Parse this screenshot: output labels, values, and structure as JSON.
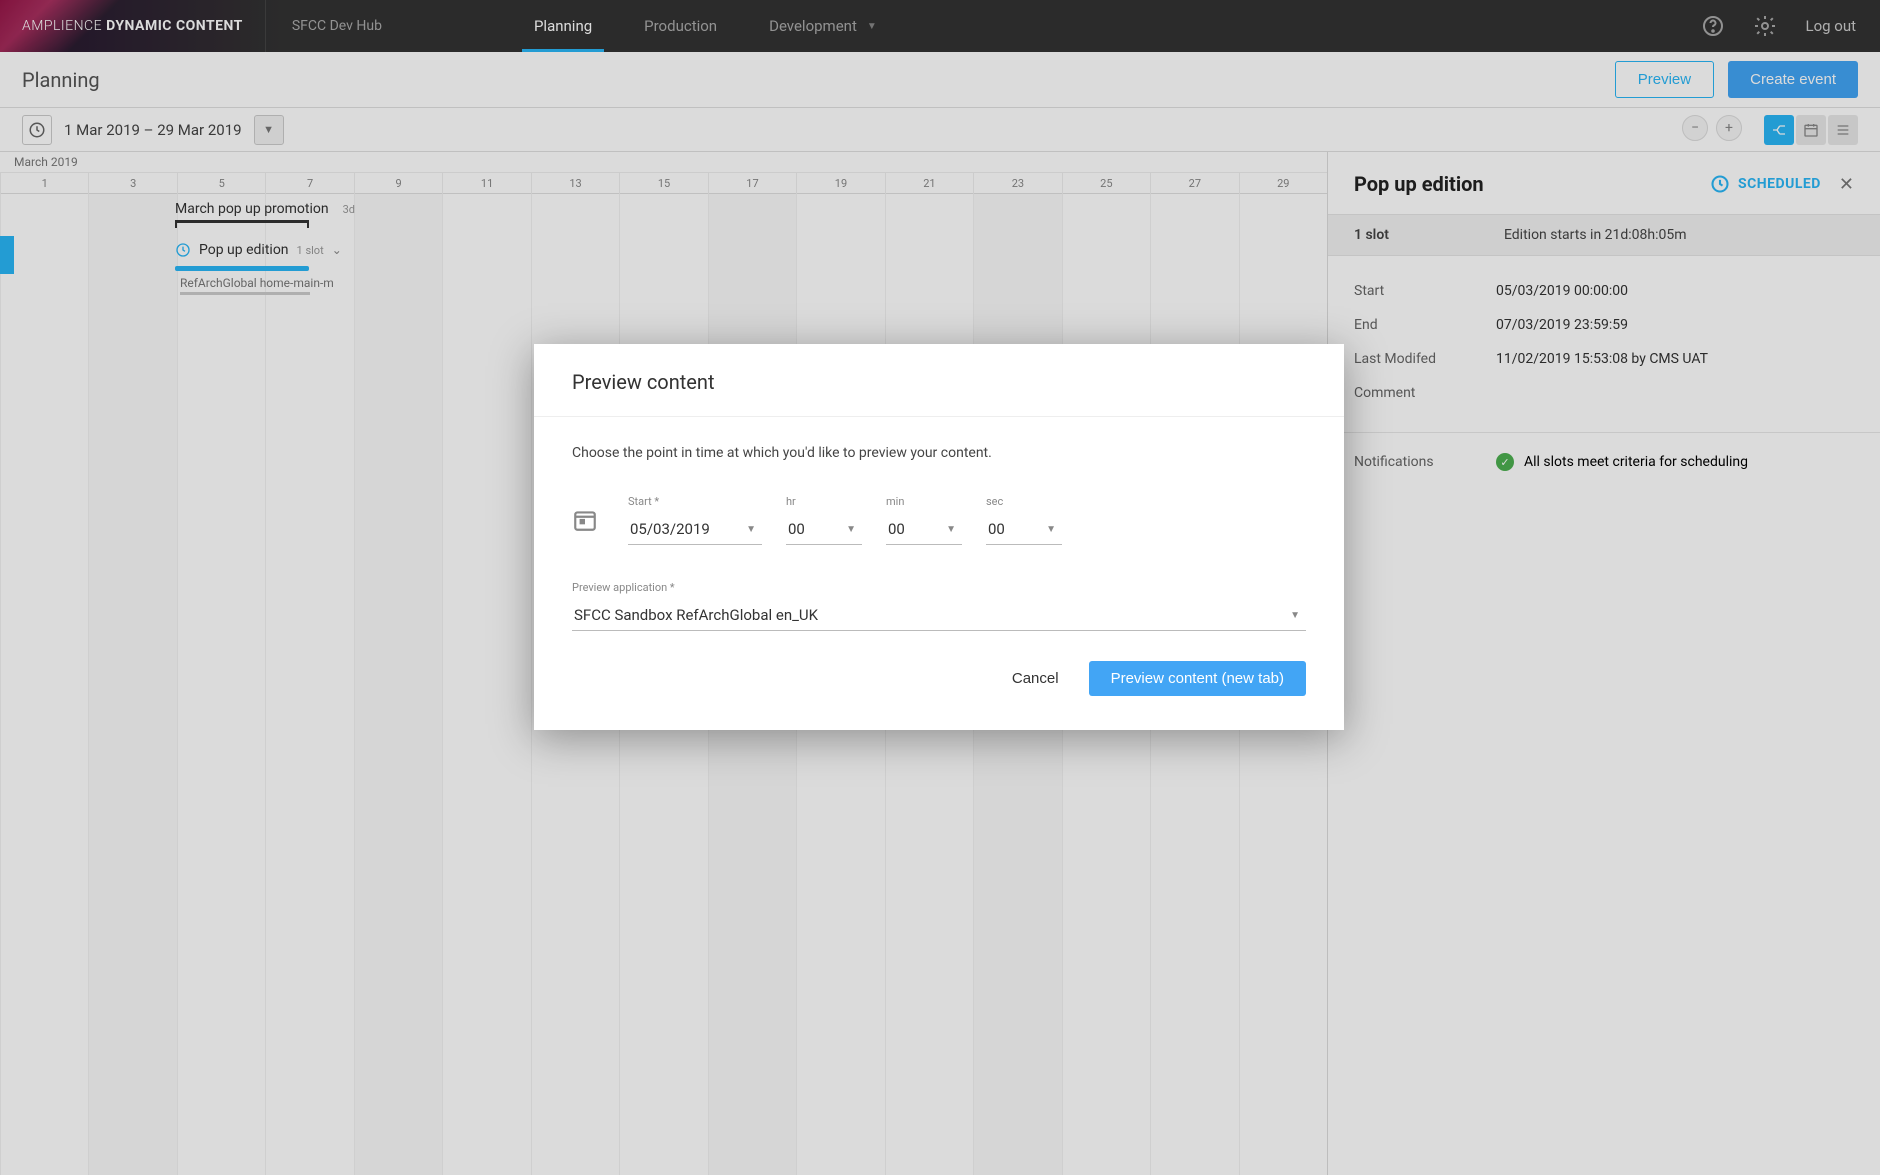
{
  "brand": {
    "light": "AMPLIENCE",
    "bold": "DYNAMIC CONTENT"
  },
  "hub": "SFCC Dev Hub",
  "nav": [
    "Planning",
    "Production",
    "Development"
  ],
  "logout": "Log out",
  "subheader": {
    "title": "Planning",
    "preview": "Preview",
    "create": "Create event"
  },
  "datebar": {
    "range": "1 Mar 2019 – 29 Mar 2019"
  },
  "month_label": "March 2019",
  "days": [
    "1",
    "3",
    "5",
    "7",
    "9",
    "11",
    "13",
    "15",
    "17",
    "19",
    "21",
    "23",
    "25",
    "27",
    "29"
  ],
  "event": {
    "name": "March pop up promotion",
    "duration": "3d"
  },
  "edition": {
    "name": "Pop up edition",
    "slot_count": "1 slot"
  },
  "slot_item": "RefArchGlobal home-main-m",
  "sidepanel": {
    "title": "Pop up edition",
    "status": "SCHEDULED",
    "slots_label": "1 slot",
    "starts_in": "Edition starts in 21d:08h:05m",
    "rows": {
      "start_label": "Start",
      "start_val": "05/03/2019 00:00:00",
      "end_label": "End",
      "end_val": "07/03/2019 23:59:59",
      "mod_label": "Last Modifed",
      "mod_val": "11/02/2019 15:53:08 by CMS UAT",
      "comment_label": "Comment"
    },
    "notif_label": "Notifications",
    "notif_msg": "All slots meet criteria for scheduling"
  },
  "modal": {
    "title": "Preview content",
    "desc": "Choose the point in time at which you'd like to preview your content.",
    "start_label": "Start *",
    "start_val": "05/03/2019",
    "hr_label": "hr",
    "hr_val": "00",
    "min_label": "min",
    "min_val": "00",
    "sec_label": "sec",
    "sec_val": "00",
    "app_label": "Preview application *",
    "app_val": "SFCC Sandbox RefArchGlobal en_UK",
    "cancel": "Cancel",
    "confirm": "Preview content (new tab)"
  }
}
